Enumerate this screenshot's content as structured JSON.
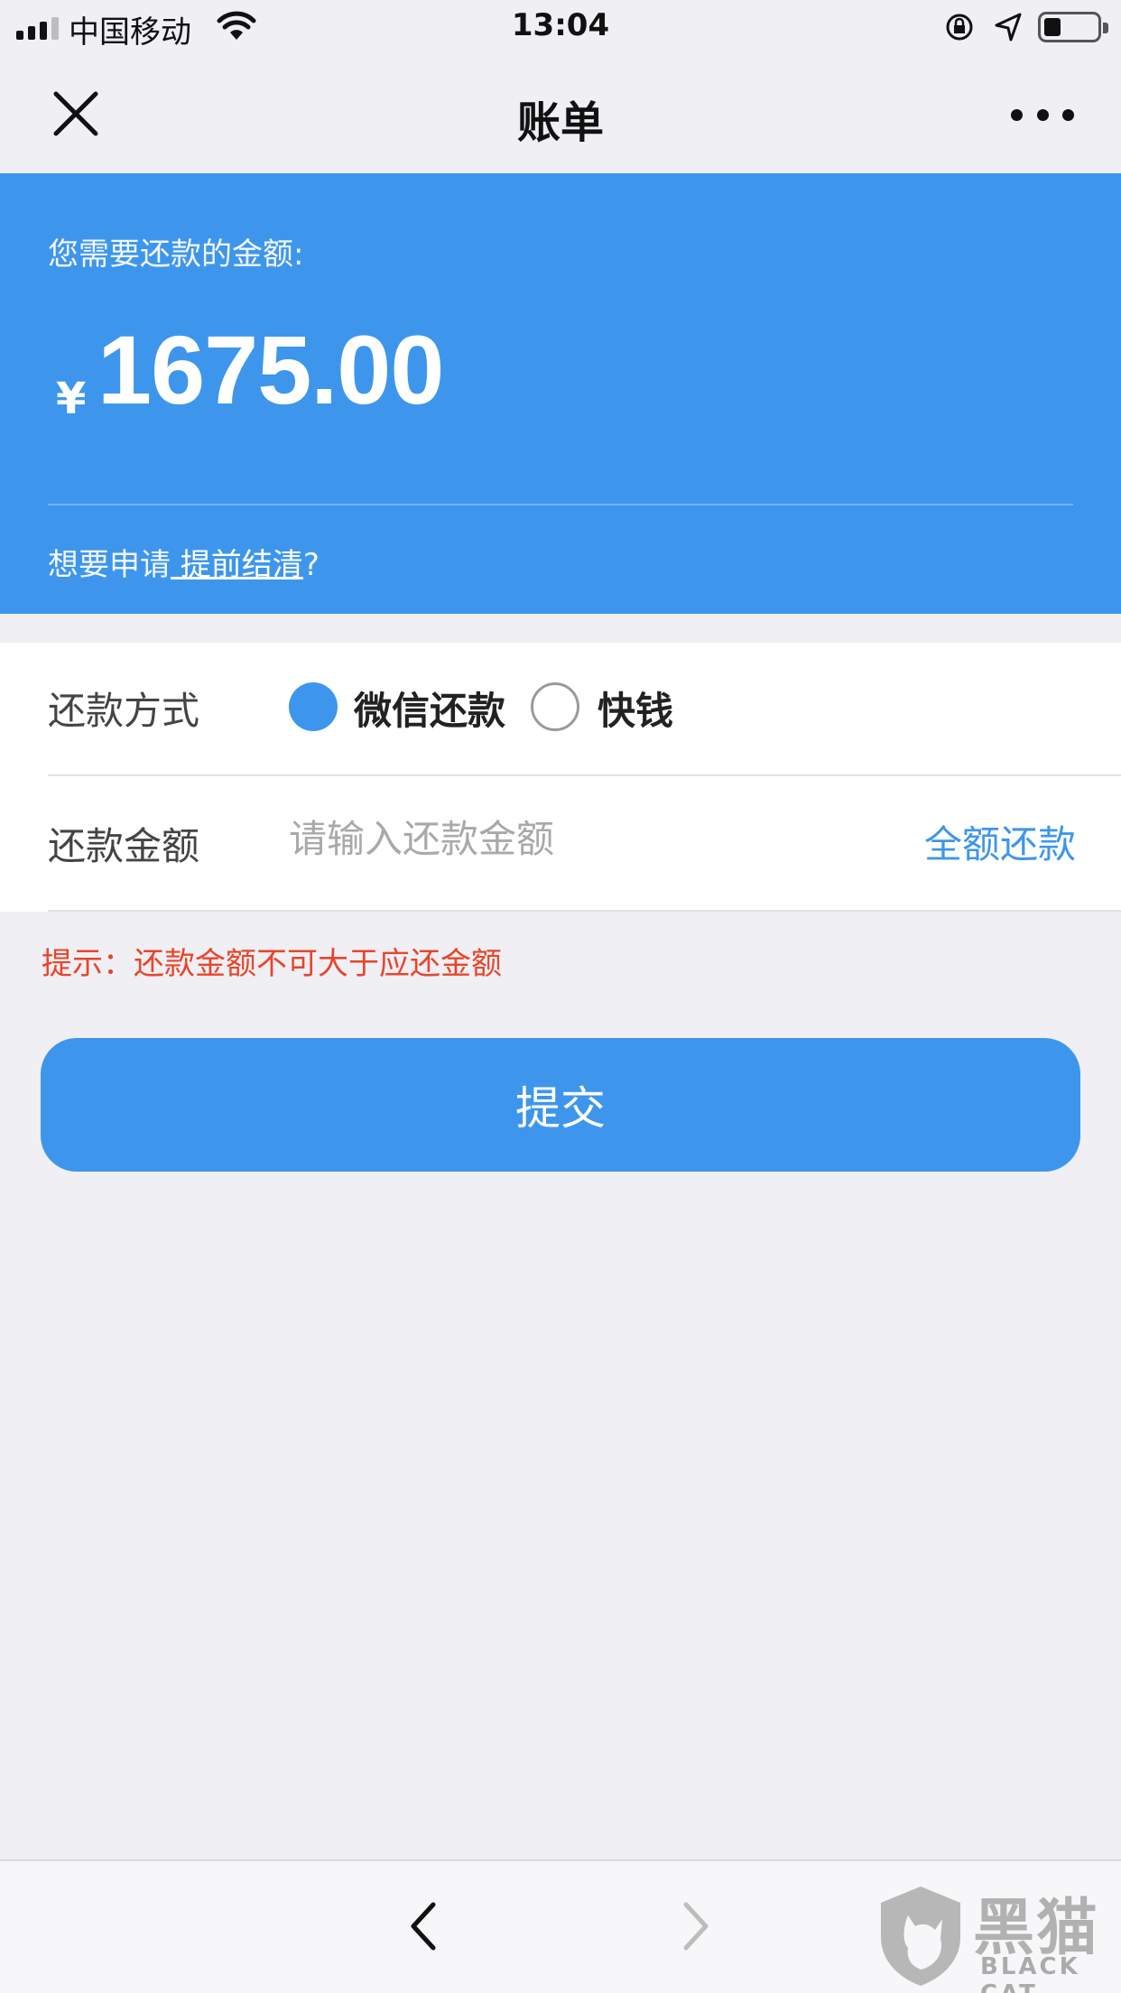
{
  "status_bar": {
    "carrier": "中国移动",
    "time": "13:04"
  },
  "nav": {
    "title": "账单",
    "close_icon": "close-icon",
    "more_icon": "more-icon"
  },
  "bill": {
    "due_label": "您需要还款的金额:",
    "currency": "¥",
    "amount": "1675.00",
    "early_prefix": "想要申请",
    "early_link": " 提前结清",
    "early_suffix": "?"
  },
  "form": {
    "method_label": "还款方式",
    "methods": [
      {
        "label": "微信还款",
        "selected": true
      },
      {
        "label": "快钱",
        "selected": false
      }
    ],
    "amount_label": "还款金额",
    "amount_placeholder": "请输入还款金额",
    "amount_value": "",
    "full_pay_label": "全额还款"
  },
  "hint": "提示：还款金额不可大于应还金额",
  "submit_label": "提交",
  "toolbar": {
    "back_icon": "chevron-left-icon",
    "forward_icon": "chevron-right-icon"
  },
  "watermark": {
    "title": "黑猫",
    "subtitle": "BLACK CAT"
  },
  "colors": {
    "accent": "#3e96ec",
    "hint": "#e8452c",
    "background": "#efeff4"
  }
}
